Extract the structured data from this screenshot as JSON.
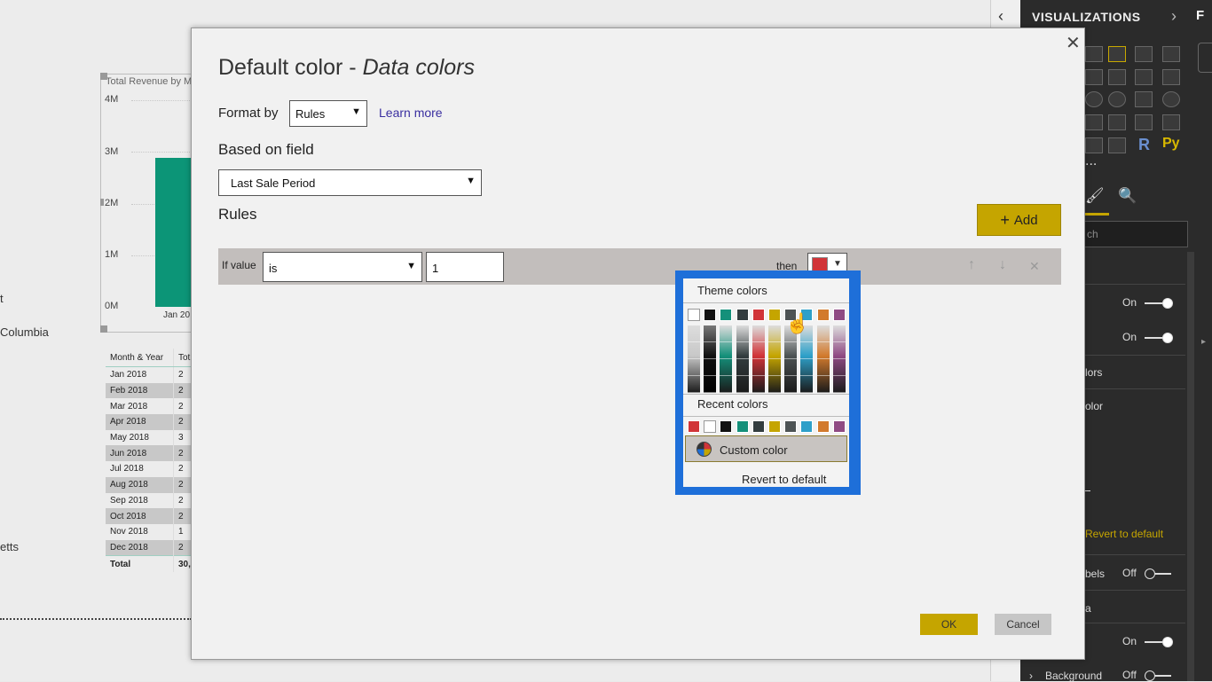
{
  "report": {
    "chart_title": "Total Revenue by M",
    "y_ticks": [
      "4M",
      "3M",
      "2M",
      "1M",
      "0M"
    ],
    "x_tick": "Jan 20",
    "side_labels": [
      "t",
      "Columbia",
      "etts"
    ],
    "table": {
      "headers": [
        "Month & Year",
        "Tot"
      ],
      "rows": [
        "Jan 2018",
        "Feb 2018",
        "Mar 2018",
        "Apr 2018",
        "May 2018",
        "Jun 2018",
        "Jul 2018",
        "Aug 2018",
        "Sep 2018",
        "Oct 2018",
        "Nov 2018",
        "Dec 2018"
      ],
      "row_second_col": [
        "2",
        "2",
        "2",
        "2",
        "3",
        "2",
        "2",
        "2",
        "2",
        "2",
        "1",
        "2"
      ],
      "total_label": "Total",
      "total_value": "30,"
    }
  },
  "viz_pane": {
    "title": "VISUALIZATIONS",
    "next_tab": "F",
    "icon_labels": {
      "r": "R",
      "py": "Py",
      "more": "..."
    },
    "search_placeholder": "ch",
    "rows": [
      {
        "label": "",
        "state": "On"
      },
      {
        "label": "",
        "state": "On"
      },
      {
        "label": "lors",
        "state": ""
      },
      {
        "label": "olor",
        "state": ""
      },
      {
        "label": "Revert to default",
        "state": ""
      },
      {
        "label": "bels",
        "state": "Off"
      },
      {
        "label": "a",
        "state": ""
      },
      {
        "label": "",
        "state": "On"
      },
      {
        "label": "Background",
        "state": "Off"
      }
    ],
    "accent": "#c5a500"
  },
  "dialog": {
    "title_main": "Default color - ",
    "title_italic": "Data colors",
    "format_by_label": "Format by",
    "format_by_value": "Rules",
    "learn_more": "Learn more",
    "based_on_field_label": "Based on field",
    "field_value": "Last Sale Period",
    "rules_label": "Rules",
    "add_label": "Add",
    "rule": {
      "if_value_label": "If value",
      "operator": "is",
      "value": "1",
      "then_label": "then",
      "color": "#d13438"
    },
    "ok_label": "OK",
    "cancel_label": "Cancel"
  },
  "color_picker": {
    "theme_header": "Theme colors",
    "theme_colors": [
      "#ffffff",
      "#111111",
      "#14907a",
      "#333d3f",
      "#d13438",
      "#c5a500",
      "#4d5354",
      "#2ea0c9",
      "#d27a2d",
      "#8f4a83"
    ],
    "recent_header": "Recent colors",
    "recent_colors": [
      "#d13438",
      "#ffffff",
      "#111111",
      "#14907a",
      "#333d3f",
      "#c5a500",
      "#4d5354",
      "#2ea0c9",
      "#d27a2d",
      "#8f4a83"
    ],
    "custom_label": "Custom color",
    "revert_label": "Revert to default",
    "highlight": "#1e6fd9"
  }
}
